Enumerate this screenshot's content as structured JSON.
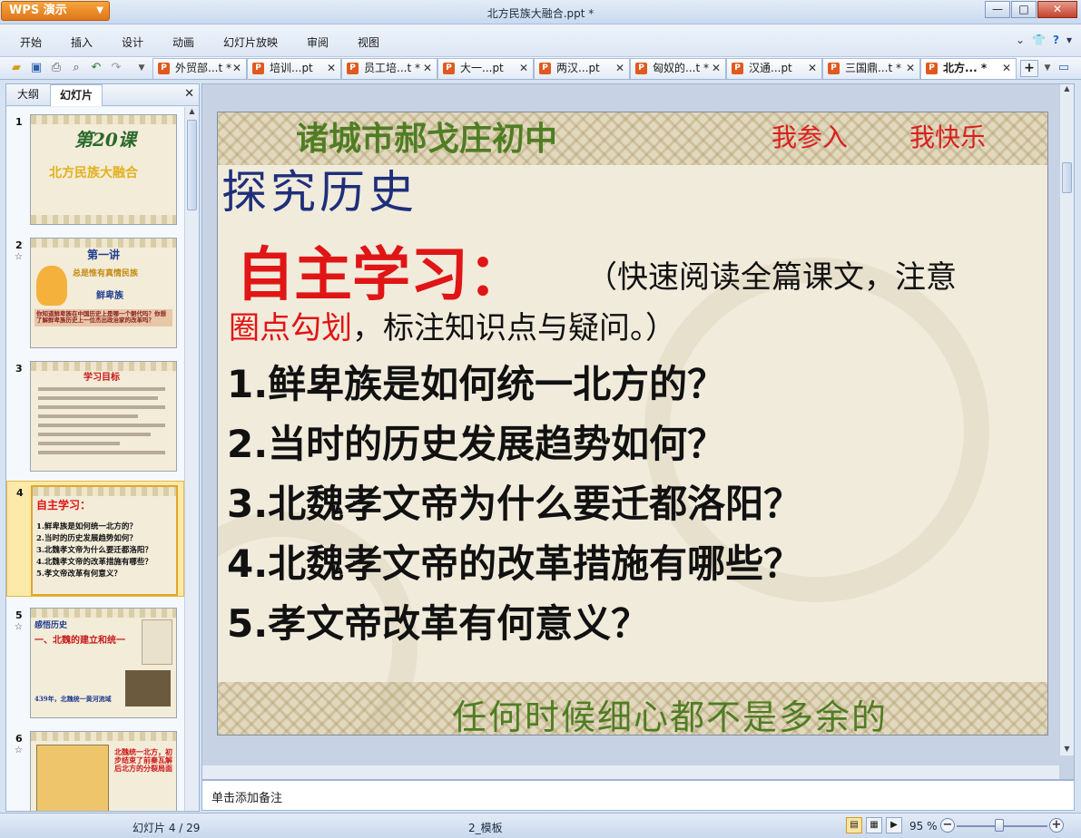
{
  "app": {
    "button_label": "WPS 演示",
    "window_title": "北方民族大融合.ppt *"
  },
  "window_controls": {
    "minimize": "—",
    "maximize": "□",
    "close": "✕"
  },
  "menu": {
    "items": [
      "开始",
      "插入",
      "设计",
      "动画",
      "幻灯片放映",
      "审阅",
      "视图"
    ],
    "right_icons": [
      "chevron-down-icon",
      "shirt-icon",
      "help-icon"
    ]
  },
  "doc_tabs": [
    {
      "label": "外贸部...t *"
    },
    {
      "label": "培训...pt"
    },
    {
      "label": "员工培...t *"
    },
    {
      "label": "大一...pt"
    },
    {
      "label": "两汉...pt"
    },
    {
      "label": "匈奴的...t *"
    },
    {
      "label": "汉通...pt"
    },
    {
      "label": "三国鼎...t *"
    },
    {
      "label": "北方... *"
    }
  ],
  "left_panel": {
    "tabs": [
      "大纲",
      "幻灯片"
    ],
    "active_tab": "幻灯片",
    "thumbnails": [
      {
        "num": "1",
        "lines": [
          "第20课",
          "北方民族大融合"
        ]
      },
      {
        "num": "2",
        "lines": [
          "第一讲",
          "总是惟有真情民族",
          "鲜卑族",
          "你知道鲜卑族在中国历史上是哪一个朝代吗？你想了解鲜卑族历史上一位杰出政治家的改革吗？"
        ]
      },
      {
        "num": "3",
        "lines": [
          "学习目标"
        ]
      },
      {
        "num": "4",
        "lines": [
          "自主学习：",
          "1.鲜卑族是如何统一北方的？",
          "2.当时的历史发展趋势如何？",
          "3.北魏孝文帝为什么要迁都洛阳？",
          "4.北魏孝文帝的改革措施有哪些？",
          "5.孝文帝改革有何意义？"
        ]
      },
      {
        "num": "5",
        "lines": [
          "感悟历史",
          "一、北魏的建立和统一",
          "439年，北魏统一黄河流域"
        ]
      },
      {
        "num": "6",
        "lines": [
          "北魏统一北方，初步结束了前秦瓦解后北方的分裂局面"
        ]
      }
    ]
  },
  "slide": {
    "school": "诸城市郝戈庄初中",
    "slogan_1": "我参入",
    "slogan_2": "我快乐",
    "heading": "探究历史",
    "self_study": "自主学习：",
    "instruction_1": "（快速阅读全篇课文，注意",
    "instruction_2_red": "圈点勾划",
    "instruction_2_rest": "，标注知识点与疑问。）",
    "questions": [
      "1.鲜卑族是如何统一北方的？",
      "2.当时的历史发展趋势如何？",
      "3.北魏孝文帝为什么要迁都洛阳？",
      "4.北魏孝文帝的改革措施有哪些？",
      "5.孝文帝改革有何意义？"
    ],
    "footer": "任何时候细心都不是多余的"
  },
  "notes_placeholder": "单击添加备注",
  "status": {
    "slide_counter": "幻灯片 4 / 29",
    "template": "2_模板",
    "zoom": "95 %"
  },
  "colors": {
    "accent_orange": "#e0761a",
    "slide_title_green": "#4f7d23",
    "slide_red": "#e01515",
    "heading_blue": "#1e2f7a"
  }
}
